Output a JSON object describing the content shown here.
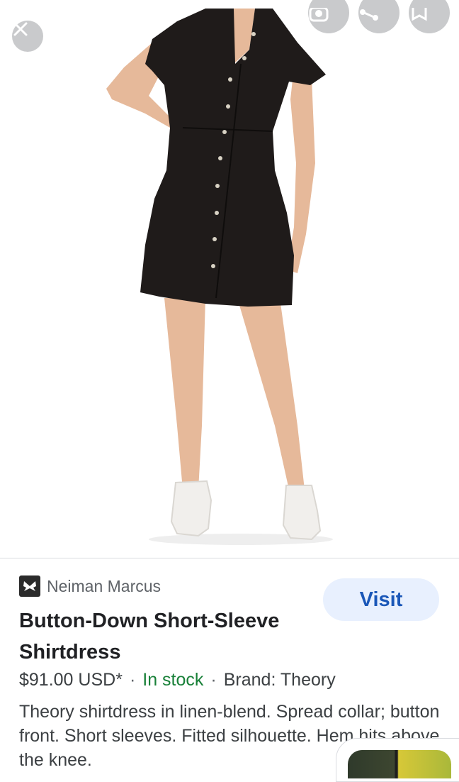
{
  "viewer": {
    "close_icon": "close-icon",
    "actions": [
      {
        "icon": "lens-icon"
      },
      {
        "icon": "share-icon"
      },
      {
        "icon": "bookmark-icon"
      }
    ]
  },
  "result": {
    "source": "Neiman Marcus",
    "source_icon": "butterfly-icon",
    "visit_label": "Visit",
    "title": "Button-Down Short-Sleeve Shirtdress",
    "price": "$91.00 USD*",
    "separator": "·",
    "stock": "In stock",
    "brand": "Brand: Theory",
    "description": "Theory shirtdress in linen-blend. Spread collar; button front. Short sleeves. Fitted silhouette. Hem hits above the knee."
  },
  "colors": {
    "accent": "#1a57b8",
    "visit_bg": "#e8f0fe",
    "stock": "#188038",
    "button_gray": "#c9cacc"
  }
}
